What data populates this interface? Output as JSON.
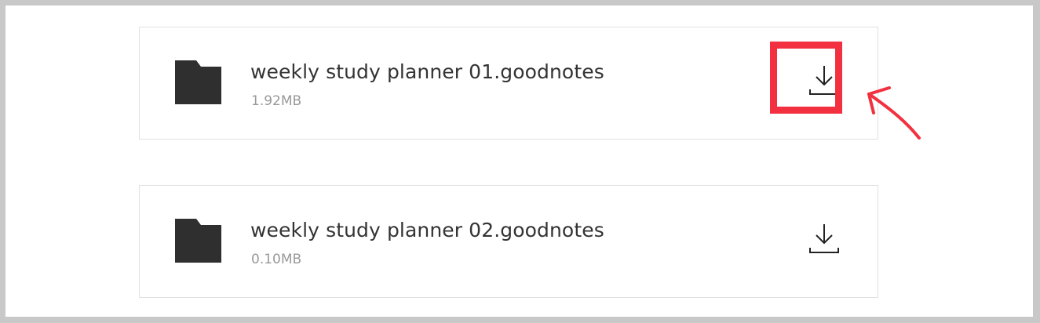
{
  "files": [
    {
      "name": "weekly study planner 01.goodnotes",
      "size": "1.92MB"
    },
    {
      "name": "weekly study planner 02.goodnotes",
      "size": "0.10MB"
    }
  ],
  "icons": {
    "file": "folder-icon",
    "download": "download-icon"
  },
  "annotation": {
    "highlighted_item": "download-button-1",
    "color": "#f2303f"
  },
  "colors": {
    "icon": "#2f2f2f",
    "text": "#333333",
    "subtext": "#999999",
    "border": "#e1e1e1",
    "highlight": "#f2303f"
  }
}
